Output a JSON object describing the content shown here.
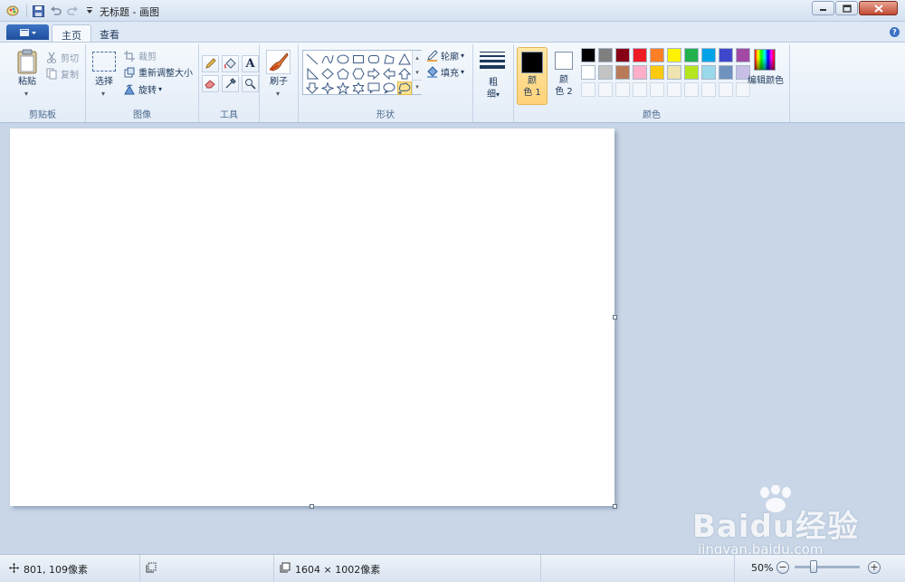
{
  "window": {
    "title": "无标题 - 画图"
  },
  "tabs": [
    {
      "label": "主页"
    },
    {
      "label": "查看"
    }
  ],
  "ribbon": {
    "clipboard": {
      "group_label": "剪贴板",
      "paste": "粘贴",
      "cut": "剪切",
      "copy": "复制"
    },
    "image": {
      "group_label": "图像",
      "select": "选择",
      "crop": "裁剪",
      "resize": "重新调整大小",
      "rotate": "旋转"
    },
    "tools": {
      "group_label": "工具"
    },
    "brushes": {
      "label": "刷子"
    },
    "shapes": {
      "group_label": "形状",
      "outline": "轮廓",
      "fill": "填充"
    },
    "size": {
      "label_line1": "粗",
      "label_line2": "细"
    },
    "colors": {
      "group_label": "颜色",
      "color1_line1": "颜",
      "color1_line2": "色 1",
      "color2_line1": "颜",
      "color2_line2": "色 2",
      "edit_colors": "编辑颜色",
      "color1_value": "#000000",
      "color2_value": "#ffffff",
      "palette_row1": [
        "#000000",
        "#7f7f7f",
        "#880015",
        "#ed1c24",
        "#ff7f27",
        "#fff200",
        "#22b14c",
        "#00a2e8",
        "#3f48cc",
        "#a349a4"
      ],
      "palette_row2": [
        "#ffffff",
        "#c3c3c3",
        "#b97a57",
        "#ffaec9",
        "#ffc90e",
        "#efe4b0",
        "#b5e61d",
        "#99d9ea",
        "#7092be",
        "#c8bfe7"
      ]
    }
  },
  "status": {
    "cursor_pos": "801, 109像素",
    "image_size": "1604 × 1002像素",
    "zoom": "50%"
  },
  "watermark": {
    "main": "Baidu经验",
    "sub": "jingyan.baidu.com"
  }
}
